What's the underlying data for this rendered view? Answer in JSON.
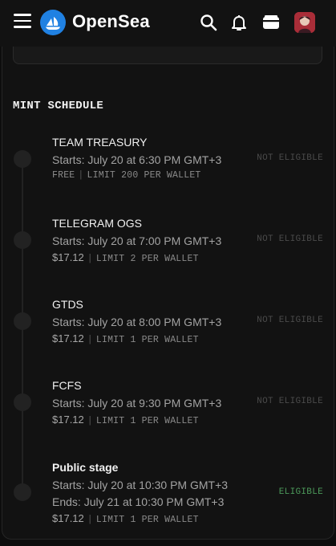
{
  "header": {
    "brand": "OpenSea",
    "icons": [
      "menu-icon",
      "opensea-logo-icon",
      "search-icon",
      "bell-icon",
      "wallet-icon",
      "avatar"
    ]
  },
  "section": {
    "title": "MINT SCHEDULE"
  },
  "stages": [
    {
      "name": "TEAM TREASURY",
      "starts": "Starts: July 20 at 6:30 PM GMT+3",
      "price": "FREE",
      "limit": "LIMIT 200 PER WALLET",
      "status": "NOT ELIGIBLE"
    },
    {
      "name": "TELEGRAM OGS",
      "starts": "Starts: July 20 at 7:00 PM GMT+3",
      "price": "$17.12",
      "limit": "LIMIT 2 PER WALLET",
      "status": "NOT ELIGIBLE"
    },
    {
      "name": "GTDS",
      "starts": "Starts: July 20 at 8:00 PM GMT+3",
      "price": "$17.12",
      "limit": "LIMIT 1 PER WALLET",
      "status": "NOT ELIGIBLE"
    },
    {
      "name": "FCFS",
      "starts": "Starts: July 20 at 9:30 PM GMT+3",
      "price": "$17.12",
      "limit": "LIMIT 1 PER WALLET",
      "status": "NOT ELIGIBLE"
    },
    {
      "name": "Public stage",
      "starts": "Starts: July 20 at 10:30 PM GMT+3",
      "ends": "Ends: July 21 at 10:30 PM GMT+3",
      "price": "$17.12",
      "limit": "LIMIT 1 PER WALLET",
      "status": "ELIGIBLE"
    }
  ],
  "colors": {
    "eligible": "#4c9a5a",
    "not_eligible": "#4a4a4a",
    "brand": "#2081e2"
  }
}
